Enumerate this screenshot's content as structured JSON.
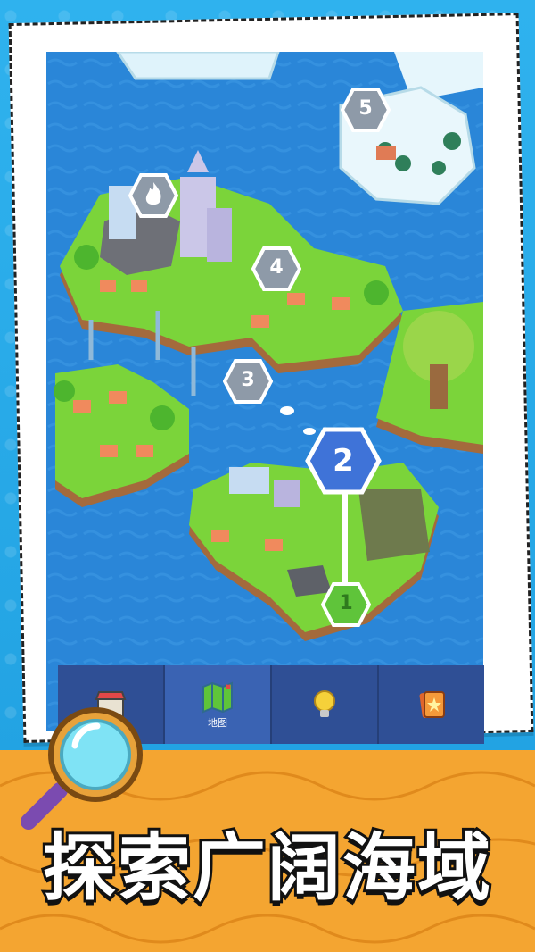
{
  "map": {
    "level_nodes": [
      {
        "label": "5",
        "state": "locked"
      },
      {
        "label": "4",
        "state": "locked"
      },
      {
        "label": "3",
        "state": "locked"
      },
      {
        "label": "2",
        "state": "current"
      },
      {
        "label": "1",
        "state": "completed"
      }
    ],
    "fire_node_icon": "fire-icon"
  },
  "navbar": {
    "tabs": [
      {
        "label": "",
        "icon": "shop-icon"
      },
      {
        "label": "地图",
        "icon": "map-icon"
      },
      {
        "label": "",
        "icon": "lightbulb-icon"
      },
      {
        "label": "",
        "icon": "cards-icon"
      }
    ]
  },
  "banner": {
    "text": "探索广阔海域"
  },
  "colors": {
    "sea": "#2a86d8",
    "grass": "#7bd43a",
    "node_locked": "#8e9aa8",
    "node_current": "#3f73d8",
    "node_completed": "#5fc43a",
    "bottom_bg": "#f4a531"
  }
}
